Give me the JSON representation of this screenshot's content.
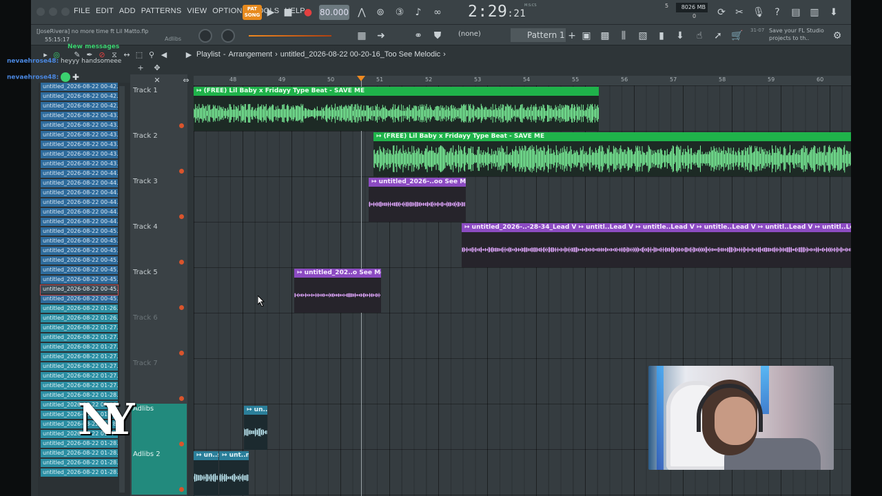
{
  "menu": [
    "FILE",
    "EDIT",
    "ADD",
    "PATTERNS",
    "VIEW",
    "OPTIONS",
    "TOOLS",
    "HELP"
  ],
  "transport": {
    "mode_label": "PAT SONG",
    "tempo": "80.000",
    "time": "2:29",
    "time_small": ":21",
    "time_units": "M:S:CS",
    "memory": "8026 MB",
    "cpu_top": "5",
    "cpu_bottom": "0"
  },
  "project": {
    "author_file": "[JoseRivera] no more time ft Lil Matto.flp",
    "elapsed": "55:15:17",
    "adlibs_label": "Adlibs"
  },
  "toolbar2": {
    "pattern_none": "(none)",
    "pattern_name": "Pattern 1",
    "hint_date": "31-07",
    "hint_text": "Save your FL Studio projects to th.."
  },
  "playlist": {
    "title_prefix": "Playlist",
    "title_sep": "-",
    "title_mode": "Arrangement",
    "title_sep2": "›",
    "title_file": "untitled_2026-08-22 00-20-16_Too See Melodic",
    "title_end": "›"
  },
  "ruler": [
    "48",
    "49",
    "50",
    "51",
    "52",
    "53",
    "54",
    "55",
    "56",
    "57",
    "58",
    "59",
    "60"
  ],
  "tracks": [
    {
      "name": "Track 1",
      "style": "normal"
    },
    {
      "name": "Track 2",
      "style": "normal"
    },
    {
      "name": "Track 3",
      "style": "normal"
    },
    {
      "name": "Track 4",
      "style": "normal"
    },
    {
      "name": "Track 5",
      "style": "normal"
    },
    {
      "name": "Track 6",
      "style": "dim"
    },
    {
      "name": "Track 7",
      "style": "dim"
    },
    {
      "name": "Adlibs",
      "style": "teal"
    },
    {
      "name": "Adlibs 2",
      "style": "teal"
    }
  ],
  "clips": {
    "c1": "↦ (FREE) Lil Baby x Fridayy Type Beat - SAVE ME",
    "c2": "↦ (FREE) Lil Baby x Fridayy Type Beat - SAVE ME",
    "c3": "↦ untitled_2026-..oo See Melodic",
    "c4": "↦ untitled_2026-..-28-34_Lead V ↦ untitl..Lead V ↦ untitle..Lead V ↦ untitle..Lead V ↦ untitl..Lead V ↦ untitl..Lead V ↦ untitl..Lead V",
    "c5": "↦ untitled_202..o See Melodic",
    "c6": "↦ un..s",
    "c7a": "↦ un..s",
    "c7b": "↦ unt..ns"
  },
  "browser": [
    {
      "t": "untitled_2026-08-22 00-42...",
      "s": "blue"
    },
    {
      "t": "untitled_2026-08-22 00-42...",
      "s": "blue"
    },
    {
      "t": "untitled_2026-08-22 00-42...",
      "s": "blue"
    },
    {
      "t": "untitled_2026-08-22 00-43...",
      "s": "blue"
    },
    {
      "t": "untitled_2026-08-22 00-43...",
      "s": "blue"
    },
    {
      "t": "untitled_2026-08-22 00-43...",
      "s": "blue"
    },
    {
      "t": "untitled_2026-08-22 00-43...",
      "s": "blue"
    },
    {
      "t": "untitled_2026-08-22 00-43...",
      "s": "blue"
    },
    {
      "t": "untitled_2026-08-22 00-43...",
      "s": "blue"
    },
    {
      "t": "untitled_2026-08-22 00-44...",
      "s": "blue"
    },
    {
      "t": "untitled_2026-08-22 00-44...",
      "s": "blue"
    },
    {
      "t": "untitled_2026-08-22 00-44...",
      "s": "blue"
    },
    {
      "t": "untitled_2026-08-22 00-44...",
      "s": "blue"
    },
    {
      "t": "untitled_2026-08-22 00-44...",
      "s": "blue"
    },
    {
      "t": "untitled_2026-08-22 00-44...",
      "s": "blue"
    },
    {
      "t": "untitled_2026-08-22 00-45...",
      "s": "blue"
    },
    {
      "t": "untitled_2026-08-22 00-45...",
      "s": "blue"
    },
    {
      "t": "untitled_2026-08-22 00-45...",
      "s": "blue"
    },
    {
      "t": "untitled_2026-08-22 00-45...",
      "s": "blue"
    },
    {
      "t": "untitled_2026-08-22 00-45...",
      "s": "blue"
    },
    {
      "t": "untitled_2026-08-22 00-45...",
      "s": "blue"
    },
    {
      "t": "untitled_2026-08-22 00-45...",
      "s": "sel"
    },
    {
      "t": "untitled_2026-08-22 00-45...",
      "s": "blue"
    },
    {
      "t": "untitled_2026-08-22 01-26...",
      "s": "cyan"
    },
    {
      "t": "untitled_2026-08-22 01-26...",
      "s": "cyan"
    },
    {
      "t": "untitled_2026-08-22 01-27...",
      "s": "cyan"
    },
    {
      "t": "untitled_2026-08-22 01-27...",
      "s": "cyan"
    },
    {
      "t": "untitled_2026-08-22 01-27...",
      "s": "cyan"
    },
    {
      "t": "untitled_2026-08-22 01-27...",
      "s": "cyan"
    },
    {
      "t": "untitled_2026-08-22 01-27...",
      "s": "cyan"
    },
    {
      "t": "untitled_2026-08-22 01-27...",
      "s": "cyan"
    },
    {
      "t": "untitled_2026-08-22 01-27...",
      "s": "cyan"
    },
    {
      "t": "untitled_2026-08-22 01-28...",
      "s": "cyan"
    },
    {
      "t": "untitled_2026-08-22 01-28...",
      "s": "cyan"
    },
    {
      "t": "untitled_2026-08-22 01-28...",
      "s": "cyan"
    },
    {
      "t": "untitled_2026-08-22 01-28...",
      "s": "cyan"
    },
    {
      "t": "untitled_2026-08-22 01-28...",
      "s": "cyan"
    },
    {
      "t": "untitled_2026-08-22 01-28...",
      "s": "cyan"
    },
    {
      "t": "untitled_2026-08-22 01-28...",
      "s": "cyan"
    },
    {
      "t": "untitled_2026-08-22 01-28...",
      "s": "cyan"
    },
    {
      "t": "untitled_2026-08-22 01-28...",
      "s": "cyan"
    }
  ],
  "chat": [
    {
      "user": "nevaehrose48:",
      "msg": " heyyy handsomeee"
    },
    {
      "user": "nevaehrose48:",
      "msg": ""
    }
  ],
  "chat_notice": "New messages",
  "colors": {
    "accent": "#f08a20",
    "green_clip": "#1fb34a",
    "purple_clip": "#8c4bc2",
    "teal_track": "#228a7d"
  }
}
